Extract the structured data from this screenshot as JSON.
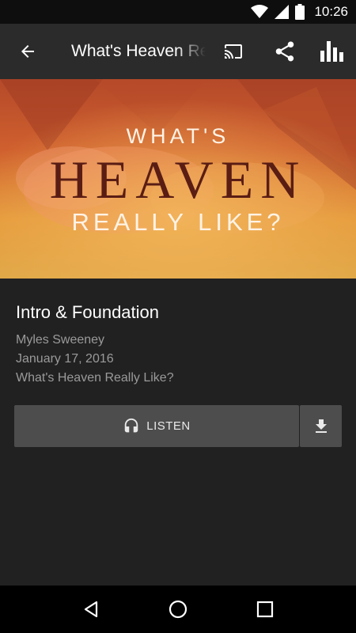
{
  "status_bar": {
    "time": "10:26"
  },
  "toolbar": {
    "title": "What's Heaven Really Like?",
    "icons": [
      "back-arrow-icon",
      "cast-icon",
      "share-icon",
      "bar-chart-icon"
    ]
  },
  "banner": {
    "line1": "WHAT'S",
    "line2": "HEAVEN",
    "line3": "REALLY LIKE?"
  },
  "episode": {
    "title": "Intro & Foundation",
    "speaker": "Myles Sweeney",
    "date": "January 17, 2016",
    "series": "What's Heaven Really Like?"
  },
  "actions": {
    "listen_label": "LISTEN",
    "listen_icon": "headphones-icon",
    "download_icon": "download-icon"
  },
  "nav": {
    "icons": [
      "back-triangle-icon",
      "home-circle-icon",
      "recents-square-icon"
    ]
  },
  "colors": {
    "background": "#212121",
    "toolbar": "#2b2b2b",
    "button": "#4d4d4d",
    "meta_text": "#9a9a9a"
  }
}
